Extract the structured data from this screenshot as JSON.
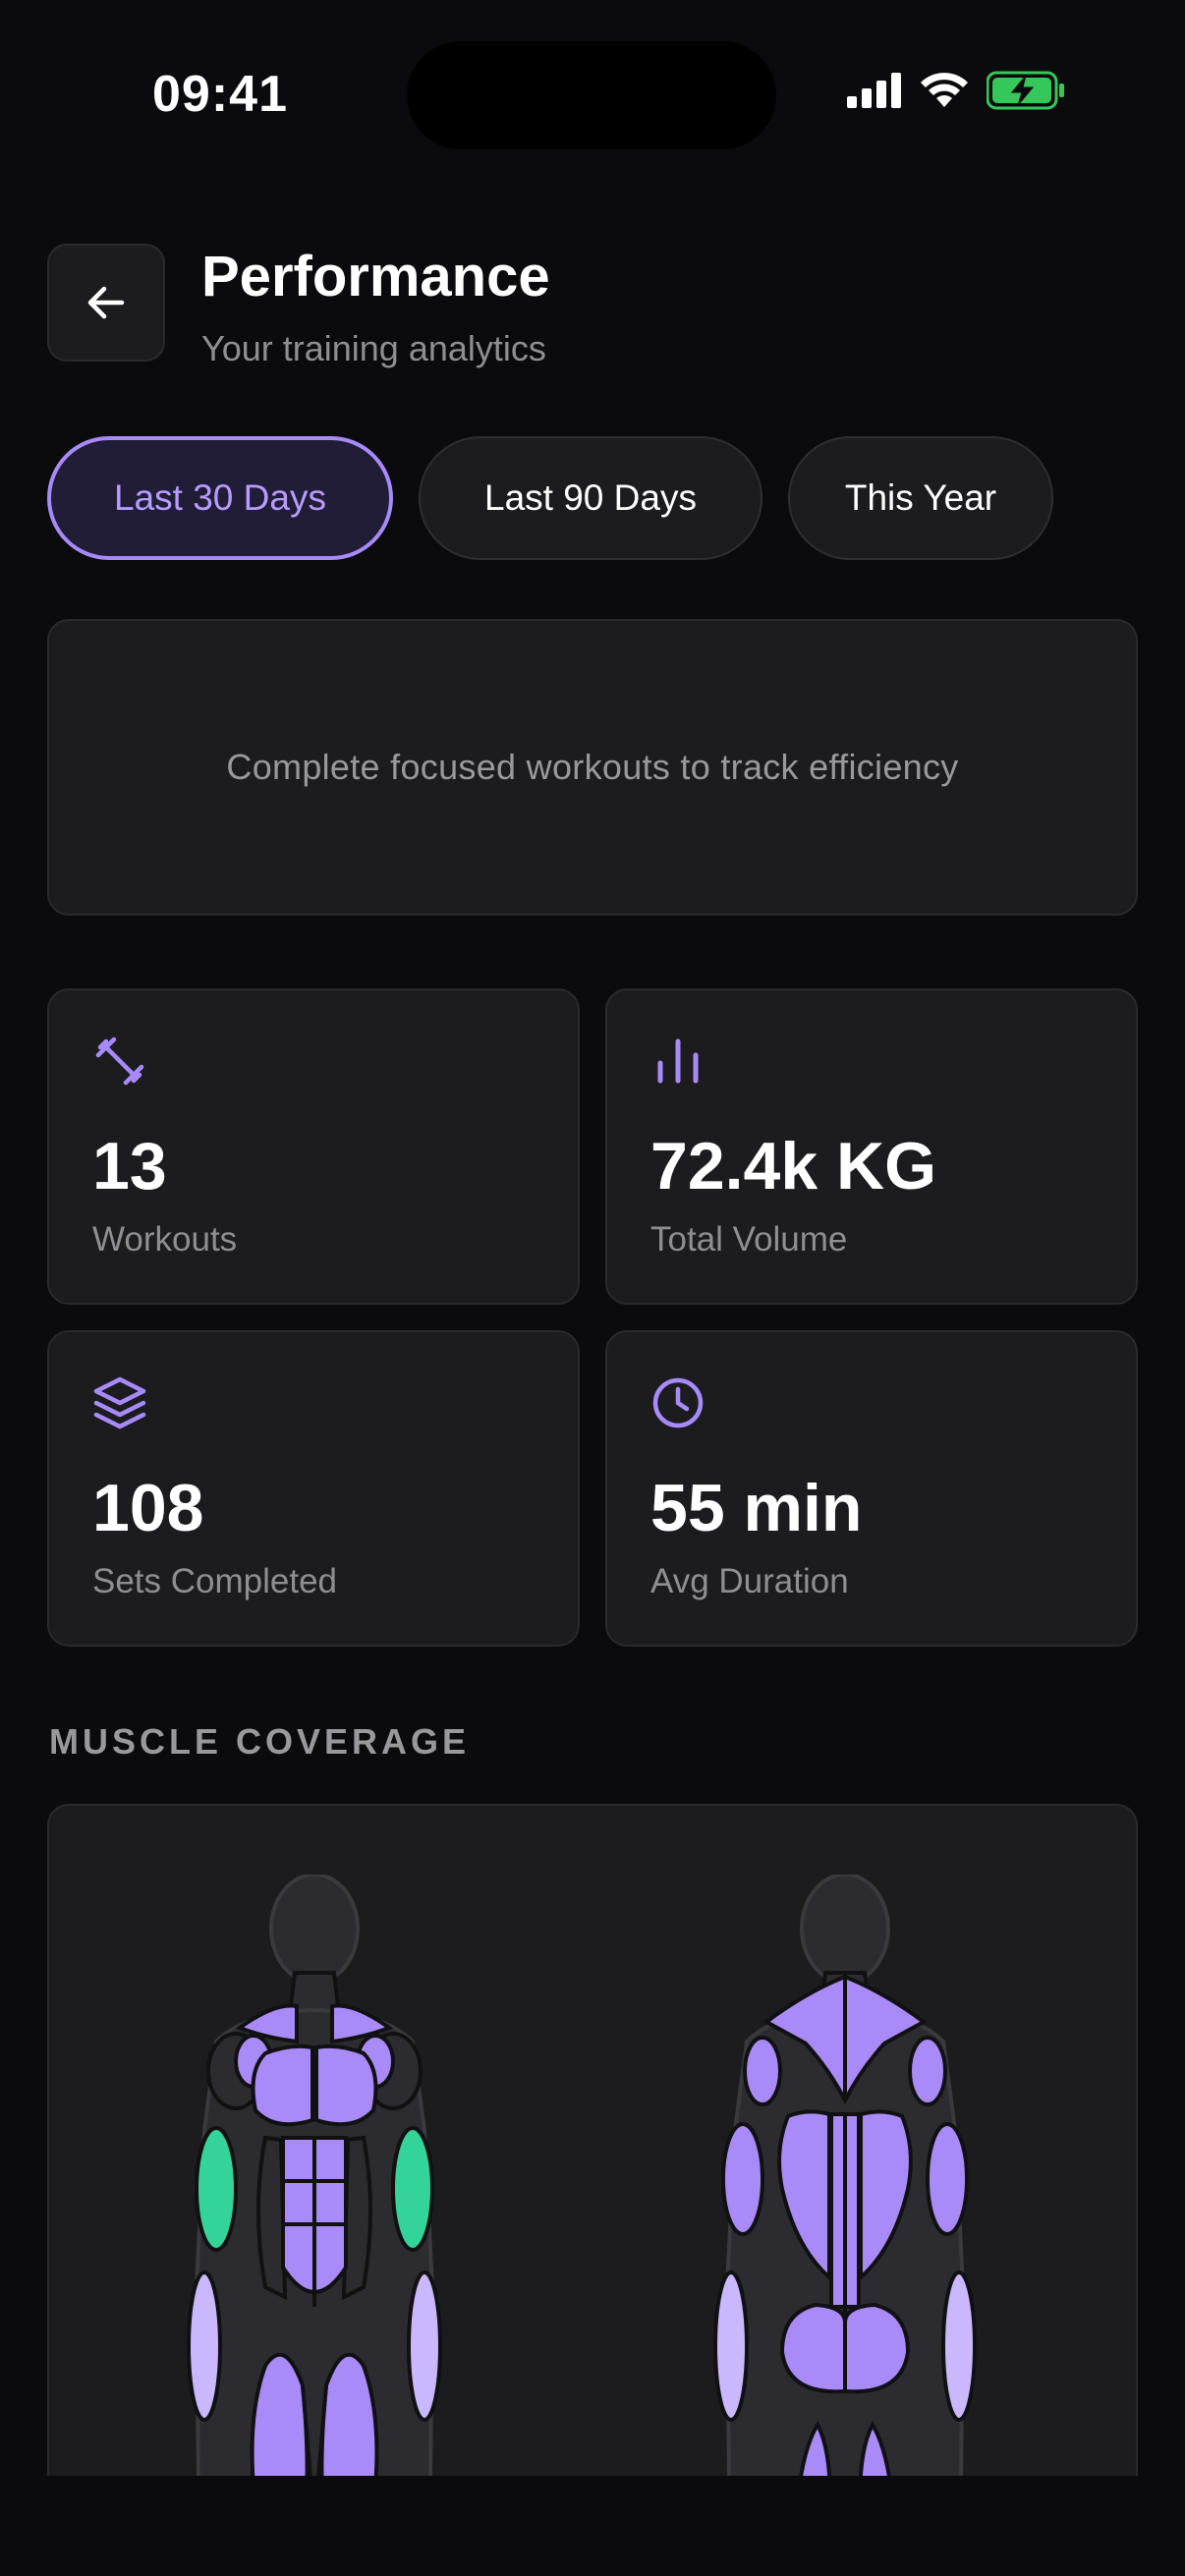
{
  "status_bar": {
    "time": "09:41",
    "icons": [
      "signal-icon",
      "wifi-icon",
      "battery-charging-icon"
    ],
    "battery_color": "#34c759"
  },
  "header": {
    "back_icon": "arrow-left-icon",
    "title": "Performance",
    "subtitle": "Your training analytics"
  },
  "filters": {
    "options": [
      "Last 30 Days",
      "Last 90 Days",
      "This Year"
    ],
    "selected": "Last 30 Days",
    "accent_color": "#a78bfa"
  },
  "efficiency": {
    "message": "Complete focused workouts to track efficiency"
  },
  "stats": [
    {
      "icon": "dumbbell-icon",
      "value": "13",
      "label": "Workouts"
    },
    {
      "icon": "bar-chart-icon",
      "value": "72.4k KG",
      "label": "Total Volume"
    },
    {
      "icon": "layers-icon",
      "value": "108",
      "label": "Sets Completed"
    },
    {
      "icon": "clock-icon",
      "value": "55 min",
      "label": "Avg Duration"
    }
  ],
  "muscle_coverage": {
    "section_title": "MUSCLE COVERAGE",
    "colors": {
      "worked": "#a98bf7",
      "light": "#c9b8fb",
      "highlight": "#34d399",
      "body": "#2c2c30",
      "outline": "#111114"
    }
  }
}
